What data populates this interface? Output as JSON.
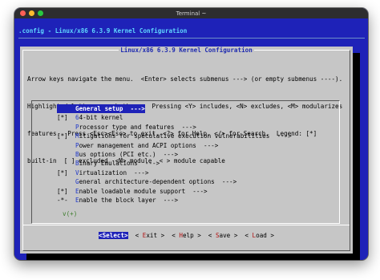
{
  "window": {
    "title": "Terminal ~"
  },
  "header": {
    "text": ".config - Linux/x86 6.3.9 Kernel Configuration"
  },
  "dialog": {
    "title": "Linux/x86 6.3.9 Kernel Configuration",
    "help_lines": [
      "Arrow keys navigate the menu.  <Enter> selects submenus ---> (or empty submenus ----).",
      "Highlighted letters are hotkeys.  Pressing <Y> includes, <N> excludes, <M> modularizes",
      "features.  Press <Esc><Esc> to exit, <?> for Help, </> for Search.  Legend: [*]",
      "built-in  [ ] excluded  <M> module  < > module capable"
    ]
  },
  "menu": {
    "items": [
      {
        "prefix": "",
        "hotkey": "G",
        "rest": "eneral setup  --->",
        "selected": true
      },
      {
        "prefix": "[*] ",
        "hotkey": "6",
        "rest": "4-bit kernel",
        "selected": false
      },
      {
        "prefix": "",
        "hotkey": "P",
        "rest": "rocessor type and features  --->",
        "selected": false
      },
      {
        "prefix": "[*] ",
        "hotkey": "M",
        "rest": "itigations for speculative execution vulnerabilities  --->",
        "selected": false
      },
      {
        "prefix": "",
        "hotkey": "P",
        "rest": "ower management and ACPI options  --->",
        "selected": false
      },
      {
        "prefix": "",
        "hotkey": "B",
        "rest": "us options (PCI etc.)  --->",
        "selected": false
      },
      {
        "prefix": "",
        "hotkey": "B",
        "rest": "inary Emulations  --->",
        "selected": false
      },
      {
        "prefix": "[*] ",
        "hotkey": "V",
        "rest": "irtualization  --->",
        "selected": false
      },
      {
        "prefix": "",
        "hotkey": "G",
        "rest": "eneral architecture-dependent options  --->",
        "selected": false
      },
      {
        "prefix": "[*] ",
        "hotkey": "E",
        "rest": "nable loadable module support  --->",
        "selected": false
      },
      {
        "prefix": "-*- ",
        "hotkey": "E",
        "rest": "nable the block layer  --->",
        "selected": false
      }
    ],
    "more_indicator": "v(+)"
  },
  "buttons": [
    {
      "pre": "<",
      "hotkey": "S",
      "post": "elect>",
      "active": true
    },
    {
      "pre": "< ",
      "hotkey": "E",
      "post": "xit >",
      "active": false
    },
    {
      "pre": "< ",
      "hotkey": "H",
      "post": "elp >",
      "active": false
    },
    {
      "pre": "< ",
      "hotkey": "S",
      "post": "ave >",
      "active": false
    },
    {
      "pre": "< ",
      "hotkey": "L",
      "post": "oad >",
      "active": false
    }
  ],
  "colors": {
    "terminal_bg": "#1e22b8",
    "dialog_bg": "#c6c6c6",
    "hotkey": "#1f37c8",
    "button_hotkey": "#b01010"
  }
}
